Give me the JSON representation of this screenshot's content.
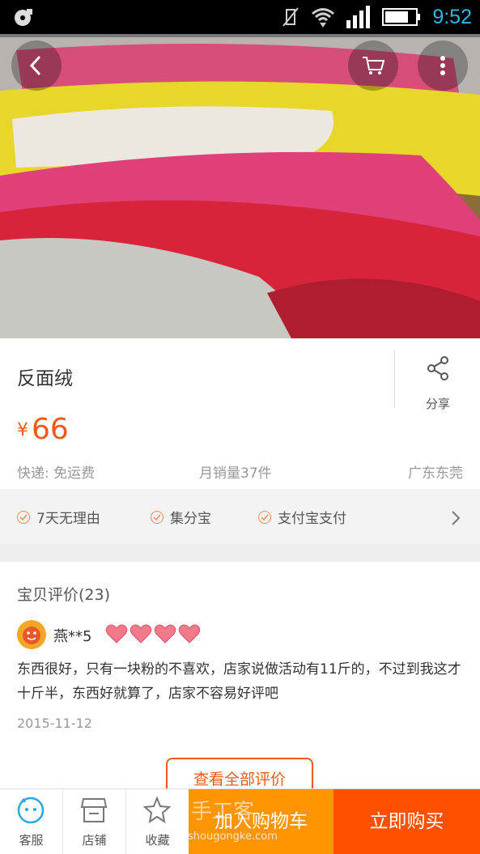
{
  "status_bar": {
    "time": "9:52"
  },
  "product": {
    "title": "反面绒",
    "share_label": "分享",
    "price_currency": "¥",
    "price": "66",
    "shipping": "快递: 免运费",
    "monthly_sales": "月销量37件",
    "location": "广东东莞"
  },
  "services": [
    "7天无理由",
    "集分宝",
    "支付宝支付"
  ],
  "reviews": {
    "header": "宝贝评价(23)",
    "user": "燕**5",
    "text": "东西很好，只有一块粉的不喜欢，店家说做活动有11斤的，不过到我这才十斤半，东西好就算了，店家不容易好评吧",
    "date": "2015-11-12",
    "view_all": "查看全部评价"
  },
  "bottom_bar": {
    "service": "客服",
    "shop": "店铺",
    "favorite": "收藏",
    "add_to_cart": "加入购物车",
    "buy_now": "立即购买"
  },
  "watermark": {
    "text": "手工客",
    "url": "shougongke.com"
  },
  "colors": {
    "accent": "#f05a18",
    "cart_button": "#ff9500",
    "buy_button": "#ff5000"
  }
}
